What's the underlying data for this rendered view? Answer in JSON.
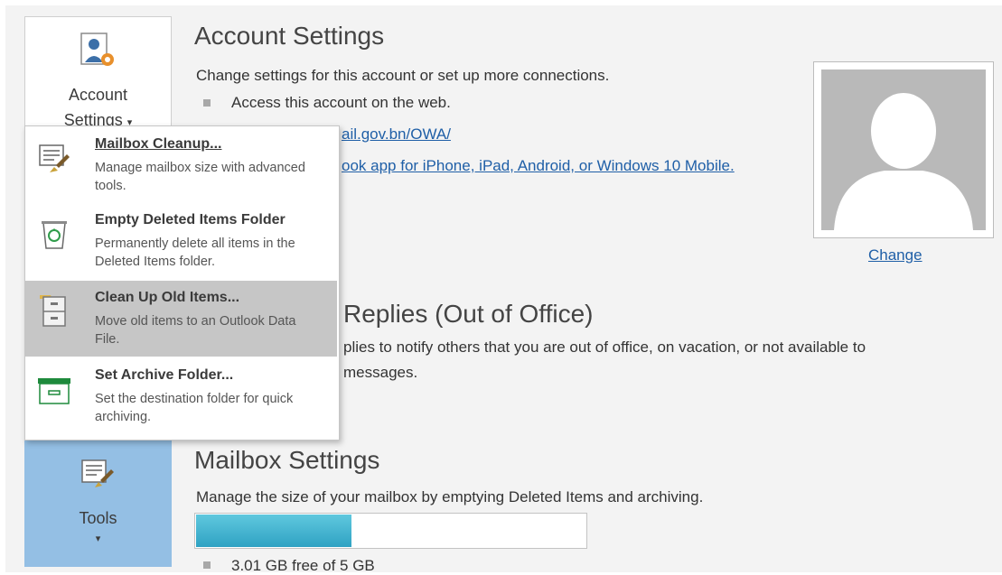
{
  "sidebar": {
    "account_settings": {
      "label_line1": "Account",
      "label_line2": "Settings",
      "dropdown_glyph": "▾",
      "icon": "account-settings-icon"
    },
    "tools": {
      "label": "Tools",
      "dropdown_glyph": "▾",
      "icon": "tools-icon"
    }
  },
  "account_section": {
    "title": "Account Settings",
    "description": "Change settings for this account or set up more connections.",
    "bullet_text": "Access this account on the web.",
    "web_link": "ail.gov.bn/OWA/",
    "mobile_link": "ook app for iPhone, iPad, Android, or Windows 10 Mobile."
  },
  "profile": {
    "change_link": "Change",
    "icon": "profile-silhouette-icon"
  },
  "auto_replies": {
    "title_fragment": "Replies (Out of Office)",
    "description_line1": "plies to notify others that you are out of office, on vacation, or not available to",
    "description_line2": "messages."
  },
  "mailbox_section": {
    "title": "Mailbox Settings",
    "description": "Manage the size of your mailbox by emptying Deleted Items and archiving.",
    "usage_fraction": 0.398,
    "free_text": "3.01 GB free of 5 GB"
  },
  "menu": {
    "items": [
      {
        "title": "Mailbox Cleanup...",
        "desc": "Manage mailbox size with advanced tools.",
        "icon": "mailbox-cleanup-icon"
      },
      {
        "title": "Empty Deleted Items Folder",
        "desc": "Permanently delete all items in the Deleted Items folder.",
        "icon": "recycle-bin-icon"
      },
      {
        "title": "Clean Up Old Items...",
        "desc": "Move old items to an Outlook Data File.",
        "icon": "file-cabinet-icon"
      },
      {
        "title": "Set Archive Folder...",
        "desc": "Set the destination folder for quick archiving.",
        "icon": "archive-box-icon"
      }
    ]
  },
  "colors": {
    "tools_bg": "#94bfe4",
    "link": "#1f5fa7",
    "progress": "#2fa2c3",
    "menu_hover": "#c6c6c6",
    "archive_green": "#1e8a3c"
  }
}
